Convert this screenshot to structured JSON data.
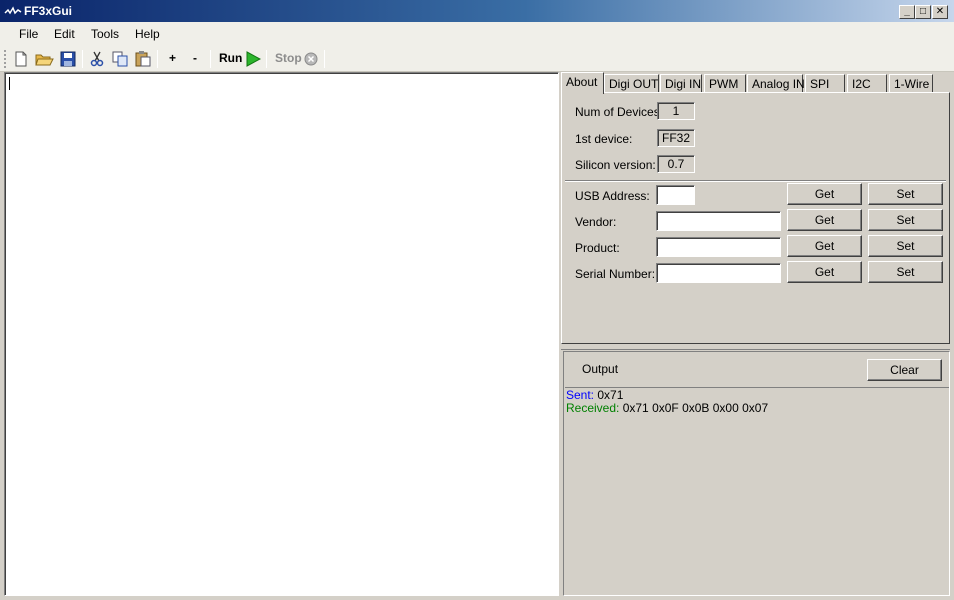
{
  "window": {
    "title": "FF3xGui",
    "min": "_",
    "max": "□",
    "close": "✕"
  },
  "menu": [
    "File",
    "Edit",
    "Tools",
    "Help"
  ],
  "toolbar": {
    "add": "+",
    "remove": "-",
    "run_label": "Run",
    "stop_label": "Stop"
  },
  "tabs": [
    "About",
    "Digi OUT",
    "Digi IN",
    "PWM",
    "Analog IN",
    "SPI",
    "I2C",
    "1-Wire"
  ],
  "about": {
    "num_devices_label": "Num of Devices:",
    "num_devices": "1",
    "first_device_label": "1st device:",
    "first_device": "FF32",
    "silicon_label": "Silicon version:",
    "silicon": "0.7",
    "fields": [
      {
        "label": "USB Address:",
        "value": "",
        "get": "Get",
        "set": "Set"
      },
      {
        "label": "Vendor:",
        "value": "",
        "get": "Get",
        "set": "Set"
      },
      {
        "label": "Product:",
        "value": "",
        "get": "Get",
        "set": "Set"
      },
      {
        "label": "Serial Number:",
        "value": "",
        "get": "Get",
        "set": "Set"
      }
    ]
  },
  "output": {
    "title": "Output",
    "clear_label": "Clear",
    "log": [
      {
        "tag": "Sent:",
        "text": " 0x71",
        "color": "#0000ff"
      },
      {
        "tag": "Received:",
        "text": " 0x71 0x0F 0x0B 0x00 0x07",
        "color": "#008000"
      }
    ]
  }
}
